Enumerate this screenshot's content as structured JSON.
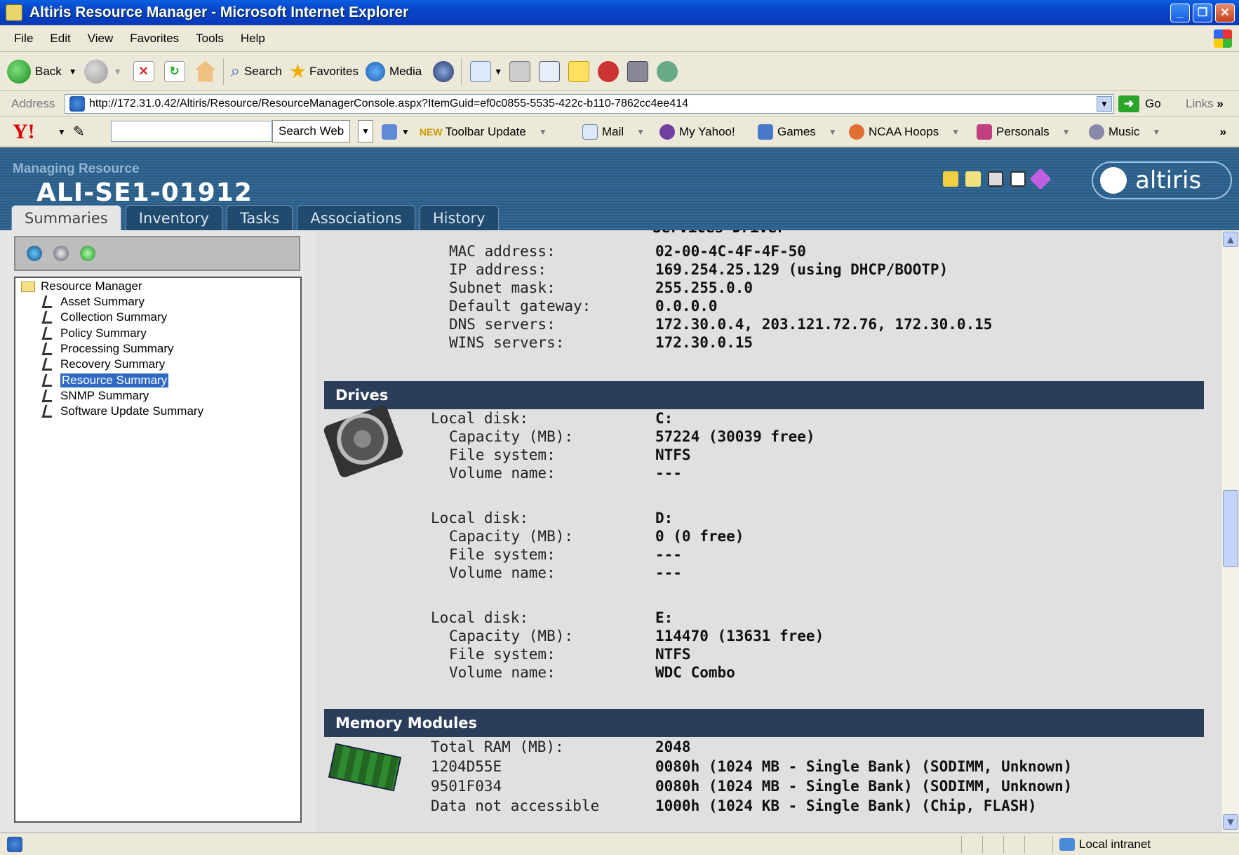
{
  "window": {
    "title": "Altiris Resource Manager - Microsoft Internet Explorer"
  },
  "menu": [
    "File",
    "Edit",
    "View",
    "Favorites",
    "Tools",
    "Help"
  ],
  "toolbar": {
    "back": "Back",
    "search": "Search",
    "favorites": "Favorites",
    "media": "Media"
  },
  "address": {
    "label": "Address",
    "url": "http://172.31.0.42/Altiris/Resource/ResourceManagerConsole.aspx?ItemGuid=ef0c0855-5535-422c-b110-7862cc4ee414",
    "go": "Go",
    "links": "Links"
  },
  "yahoo": {
    "logo": "Y!",
    "search_btn": "Search Web",
    "new_badge": "NEW",
    "toolbar_update": "Toolbar Update",
    "mail": "Mail",
    "my_yahoo": "My Yahoo!",
    "games": "Games",
    "ncaa": "NCAA Hoops",
    "personals": "Personals",
    "music": "Music",
    "more": "»"
  },
  "header": {
    "managing": "Managing Resource",
    "resource_name": "ALI-SE1-01912",
    "logo": "altiris"
  },
  "tabs": [
    "Summaries",
    "Inventory",
    "Tasks",
    "Associations",
    "History"
  ],
  "tree": {
    "root": "Resource Manager",
    "items": [
      "Asset Summary",
      "Collection Summary",
      "Policy Summary",
      "Processing Summary",
      "Recovery Summary",
      "Resource Summary",
      "SNMP Summary",
      "Software Update Summary"
    ],
    "selected": "Resource Summary"
  },
  "network": {
    "partial_label": "Services Driver",
    "rows": [
      {
        "k": "MAC address:",
        "v": "02-00-4C-4F-4F-50"
      },
      {
        "k": "IP address:",
        "v": "169.254.25.129 (using DHCP/BOOTP)"
      },
      {
        "k": "Subnet mask:",
        "v": "255.255.0.0"
      },
      {
        "k": "Default gateway:",
        "v": "0.0.0.0"
      },
      {
        "k": "DNS servers:",
        "v": "172.30.0.4, 203.121.72.76, 172.30.0.15"
      },
      {
        "k": "WINS servers:",
        "v": "172.30.0.15"
      }
    ]
  },
  "drives": {
    "title": "Drives",
    "disks": [
      {
        "local": "Local disk:",
        "letter": "C:",
        "capacity_k": "Capacity (MB):",
        "capacity": "57224 (30039 free)",
        "fs_k": "File system:",
        "fs": "NTFS",
        "vol_k": "Volume name:",
        "vol": "---"
      },
      {
        "local": "Local disk:",
        "letter": "D:",
        "capacity_k": "Capacity (MB):",
        "capacity": "0 (0 free)",
        "fs_k": "File system:",
        "fs": "---",
        "vol_k": "Volume name:",
        "vol": "---"
      },
      {
        "local": "Local disk:",
        "letter": "E:",
        "capacity_k": "Capacity (MB):",
        "capacity": "114470 (13631 free)",
        "fs_k": "File system:",
        "fs": "NTFS",
        "vol_k": "Volume name:",
        "vol": "WDC Combo"
      }
    ]
  },
  "memory": {
    "title": "Memory Modules",
    "rows": [
      {
        "k": "Total RAM (MB):",
        "v": "2048"
      },
      {
        "k": "1204D55E",
        "v": "0080h (1024 MB - Single Bank) (SODIMM, Unknown)"
      },
      {
        "k": "9501F034",
        "v": "0080h (1024 MB - Single Bank) (SODIMM, Unknown)"
      },
      {
        "k": "Data not accessible",
        "v": "1000h (1024 KB - Single Bank) (Chip, FLASH)"
      }
    ]
  },
  "status": {
    "zone": "Local intranet"
  }
}
